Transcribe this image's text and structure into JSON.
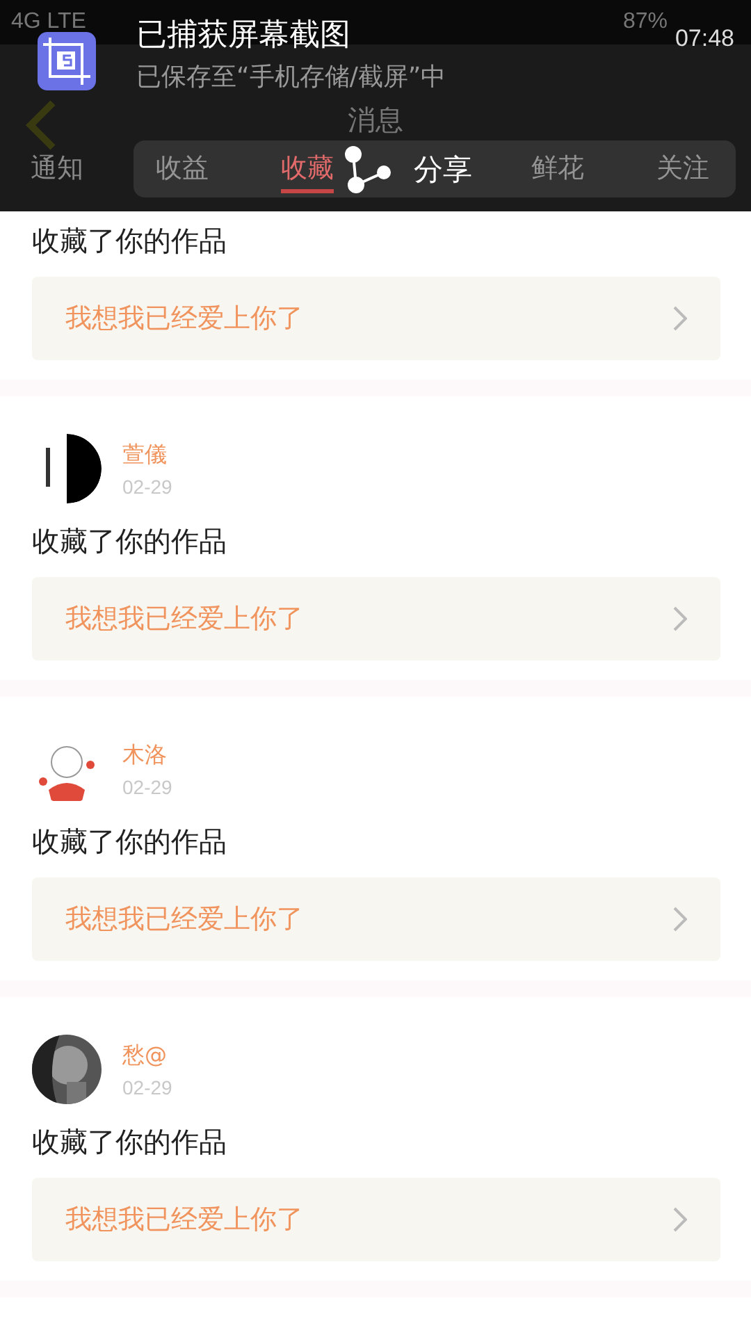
{
  "status_bar": {
    "network": "4G LTE",
    "battery": "87%"
  },
  "header": {
    "title": "消息"
  },
  "tabs": [
    {
      "label": "通知",
      "selected": false
    },
    {
      "label": "收益",
      "selected": false
    },
    {
      "label": "收藏",
      "selected": true
    },
    {
      "label": "鲜花",
      "selected": false
    },
    {
      "label": "关注",
      "selected": false
    }
  ],
  "notification": {
    "title": "已捕获屏幕截图",
    "subtitle": "已保存至“手机存储/截屏”中",
    "time": "07:48",
    "share_label": "分享"
  },
  "partial_item": {
    "action": "收藏了你的作品",
    "work": "我想我已经爱上你了"
  },
  "items": [
    {
      "name": "萱儀",
      "date": "02-29",
      "action": "收藏了你的作品",
      "work": "我想我已经爱上你了"
    },
    {
      "name": "木洛",
      "date": "02-29",
      "action": "收藏了你的作品",
      "work": "我想我已经爱上你了"
    },
    {
      "name": "愁@",
      "date": "02-29",
      "action": "收藏了你的作品",
      "work": "我想我已经爱上你了"
    }
  ]
}
